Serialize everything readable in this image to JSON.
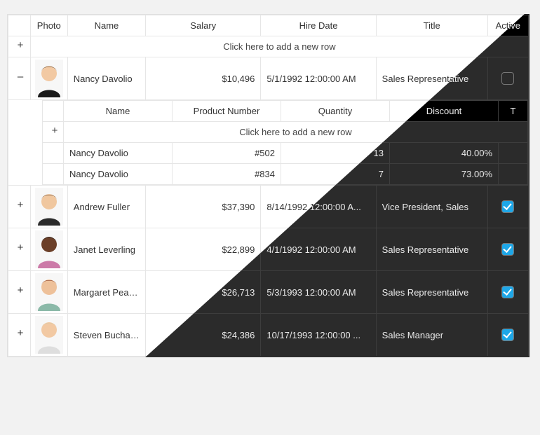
{
  "columns": {
    "photo": "Photo",
    "name": "Name",
    "salary": "Salary",
    "hireDate": "Hire Date",
    "title": "Title",
    "active": "Active"
  },
  "addRowText": "Click here to add a new row",
  "detailColumns": {
    "name": "Name",
    "productNumber": "Product Number",
    "quantity": "Quantity",
    "discount": "Discount",
    "truncatedLast": "T"
  },
  "employees": [
    {
      "name": "Nancy Davolio",
      "salary": "$10,496",
      "hireDate": "5/1/1992 12:00:00 AM",
      "title": "Sales Representative",
      "active": false,
      "avatar": {
        "skin": "#f2c9a3",
        "hair": "#402a17",
        "shirt": "#1a1a1a"
      }
    },
    {
      "name": "Andrew Fuller",
      "salary": "$37,390",
      "hireDate": "8/14/1992 12:00:00 A...",
      "title": "Vice President, Sales",
      "active": true,
      "avatar": {
        "skin": "#f0c79f",
        "hair": "#4b2f18",
        "shirt": "#2b2b2b"
      }
    },
    {
      "name": "Janet Leverling",
      "salary": "$22,899",
      "hireDate": "4/1/1992 12:00:00 AM",
      "title": "Sales Representative",
      "active": true,
      "avatar": {
        "skin": "#6b3f28",
        "hair": "#141414",
        "shirt": "#cc7aa8"
      }
    },
    {
      "name": "Margaret  Peac...",
      "salary": "$26,713",
      "hireDate": "5/3/1993 12:00:00 AM",
      "title": "Sales Representative",
      "active": true,
      "avatar": {
        "skin": "#eec19a",
        "hair": "#7a2f18",
        "shirt": "#8bb9a8"
      }
    },
    {
      "name": "Steven  Buchan...",
      "salary": "$24,386",
      "hireDate": "10/17/1993 12:00:00 ...",
      "title": "Sales Manager",
      "active": true,
      "avatar": {
        "skin": "#f2c9a3",
        "hair": "#d6c9a8",
        "shirt": "#dedede"
      }
    }
  ],
  "detailRows": [
    {
      "name": "Nancy Davolio",
      "productNumber": "#502",
      "quantity": "13",
      "discount": "40.00%"
    },
    {
      "name": "Nancy Davolio",
      "productNumber": "#834",
      "quantity": "7",
      "discount": "73.00%"
    }
  ]
}
